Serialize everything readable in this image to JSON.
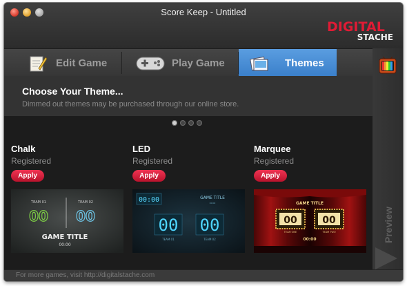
{
  "window": {
    "title": "Score Keep - Untitled"
  },
  "logo": {
    "line1": "DIGITAL",
    "line2": "STACHE"
  },
  "tabs": [
    {
      "label": "Edit Game",
      "icon": "edit-game-icon"
    },
    {
      "label": "Play Game",
      "icon": "gamepad-icon"
    },
    {
      "label": "Themes",
      "icon": "themes-icon",
      "active": true
    }
  ],
  "panel": {
    "title": "Choose Your Theme...",
    "subtitle": "Dimmed out themes may be purchased through our online store."
  },
  "pager": {
    "count": 4,
    "current": 1
  },
  "themes": [
    {
      "name": "Chalk",
      "status": "Registered",
      "apply_label": "Apply",
      "preview": {
        "team1": "TEAM 01",
        "team2": "TEAM 02",
        "score1": "00",
        "score2": "00",
        "game_title": "GAME TITLE",
        "time": "00:00"
      }
    },
    {
      "name": "LED",
      "status": "Registered",
      "apply_label": "Apply",
      "preview": {
        "clock": "00:00",
        "game_title": "GAME TITLE",
        "period": "00:00",
        "score1": "00",
        "score2": "00",
        "team1": "TEAM 01",
        "team2": "TEAM 02"
      }
    },
    {
      "name": "Marquee",
      "status": "Registered",
      "apply_label": "Apply",
      "preview": {
        "game_title": "GAME TITLE",
        "score1": "00",
        "score2": "00",
        "team1": "TEAM ONE",
        "team2": "TEAM TWO",
        "time": "00:00"
      }
    }
  ],
  "sidebar": {
    "preview_label": "Preview"
  },
  "footer": {
    "text": "For more games, visit http://digitalstache.com"
  }
}
